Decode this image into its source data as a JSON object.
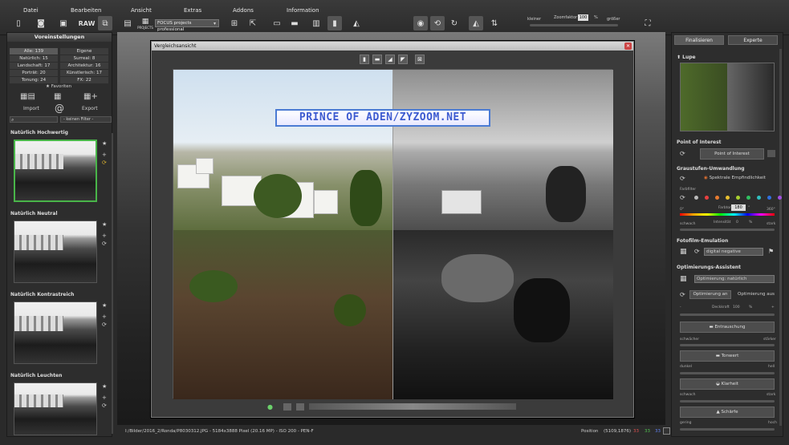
{
  "menu": [
    "Datei",
    "Bearbeiten",
    "Ansicht",
    "Extras",
    "Addons",
    "Information"
  ],
  "toolbar": {
    "raw_label": "RAW",
    "projects_label": "PROJECTS",
    "preset_select": "FOCUS projects professional",
    "kleiner": "kleiner",
    "zoomfaktor": "Zoomfaktor",
    "zoom_value": "100",
    "zoom_unit": "%",
    "groesser": "größer"
  },
  "left": {
    "title": "Voreinstellungen",
    "counts": [
      [
        "Alle: 139",
        "Eigene"
      ],
      [
        "Natürlich: 15",
        "Surreal: 8"
      ],
      [
        "Landschaft: 17",
        "Architektur: 16"
      ],
      [
        "Porträt: 20",
        "Künstlerisch: 17"
      ],
      [
        "Tonung: 24",
        "FX: 22"
      ]
    ],
    "favoriten": "Favoriten",
    "import": "Import",
    "export": "Export",
    "filter": "- keinen Filter -",
    "thumbs": [
      "Natürlich Hochwertig",
      "Natürlich Neutral",
      "Natürlich Kontrastreich",
      "Natürlich Leuchten"
    ]
  },
  "dialog": {
    "title": "Vergleichsansicht",
    "watermark": "PRINCE OF ADEN/ZYZOOM.NET"
  },
  "status": {
    "file": "I:/Bilder/2016_2/Ronda/P8030312.JPG - 5184x3888 Pixel (20.16 MP) - ISO 200 - PEN-F",
    "position_label": "Position",
    "position_value": "(5109,1876)",
    "r": "33",
    "g": "33",
    "b": "33"
  },
  "right": {
    "tab1": "Finalisieren",
    "tab2": "Experte",
    "lupe": "Lupe",
    "poi": "Point of Interest",
    "poi_btn": "Point of Interest",
    "grau": "Graustufen-Umwandlung",
    "spektral": "Spektrale Empfindlichkeit",
    "farbfilter": "Farbfilter",
    "farbton": "Farbton",
    "farbton_val": "180",
    "deg0": "0°",
    "deg360": "360°",
    "schwach": "schwach",
    "intensitat": "Intensität",
    "intensitat_val": "0",
    "stark": "stark",
    "pct": "%",
    "fotofilm": "Fotofilm-Emulation",
    "film_select": "digital negative",
    "optim": "Optimierungs-Assistent",
    "optim_select": "Optimierung: natürlich",
    "optim_an": "Optimierung an",
    "optim_aus": "Optimierung aus",
    "minus": "-",
    "plus": "+",
    "deckkraft": "Deckkraft",
    "deckkraft_val": "100",
    "entrauschung": "Entrauschung",
    "schwaecher": "schwächer",
    "staerker": "stärker",
    "tonwert": "Tonwert",
    "dunkel": "dunkel",
    "hell": "hell",
    "klarheit": "Klarheit",
    "schaerfe": "Schärfe",
    "gering": "gering",
    "hoch": "hoch"
  },
  "colors": {
    "accent_green": "#49b549",
    "farbfilter_dots": [
      "#bbbbbb",
      "#e84040",
      "#e87b30",
      "#e8c030",
      "#a8d030",
      "#30c060",
      "#30c0c0",
      "#3070e0",
      "#a050e0"
    ]
  }
}
